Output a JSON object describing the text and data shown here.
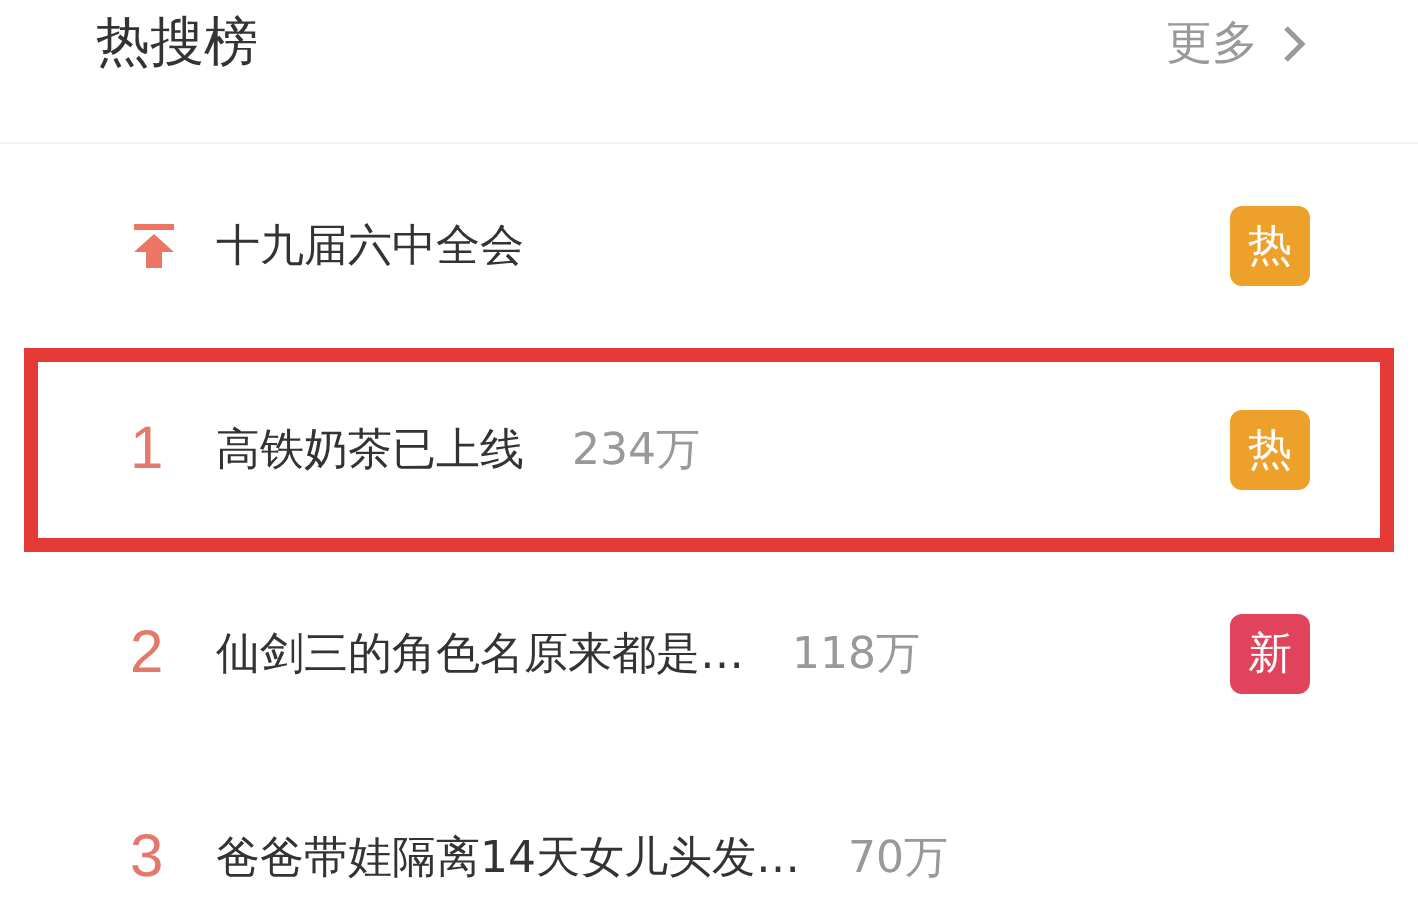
{
  "header": {
    "title": "热搜榜",
    "more": "更多"
  },
  "items": [
    {
      "kind": "pinned",
      "title": "十九届六中全会",
      "highlighted": false,
      "badge": {
        "kind": "hot",
        "text": "热"
      }
    },
    {
      "kind": "ranked",
      "rank": "1",
      "title": "高铁奶茶已上线",
      "count": "234万",
      "highlighted": true,
      "badge": {
        "kind": "hot",
        "text": "热"
      }
    },
    {
      "kind": "ranked",
      "rank": "2",
      "title": "仙剑三的角色名原来都是…",
      "count": "118万",
      "highlighted": false,
      "badge": {
        "kind": "new",
        "text": "新"
      }
    },
    {
      "kind": "ranked",
      "rank": "3",
      "title": "爸爸带娃隔离14天女儿头发…",
      "count": "70万",
      "highlighted": false
    }
  ]
}
